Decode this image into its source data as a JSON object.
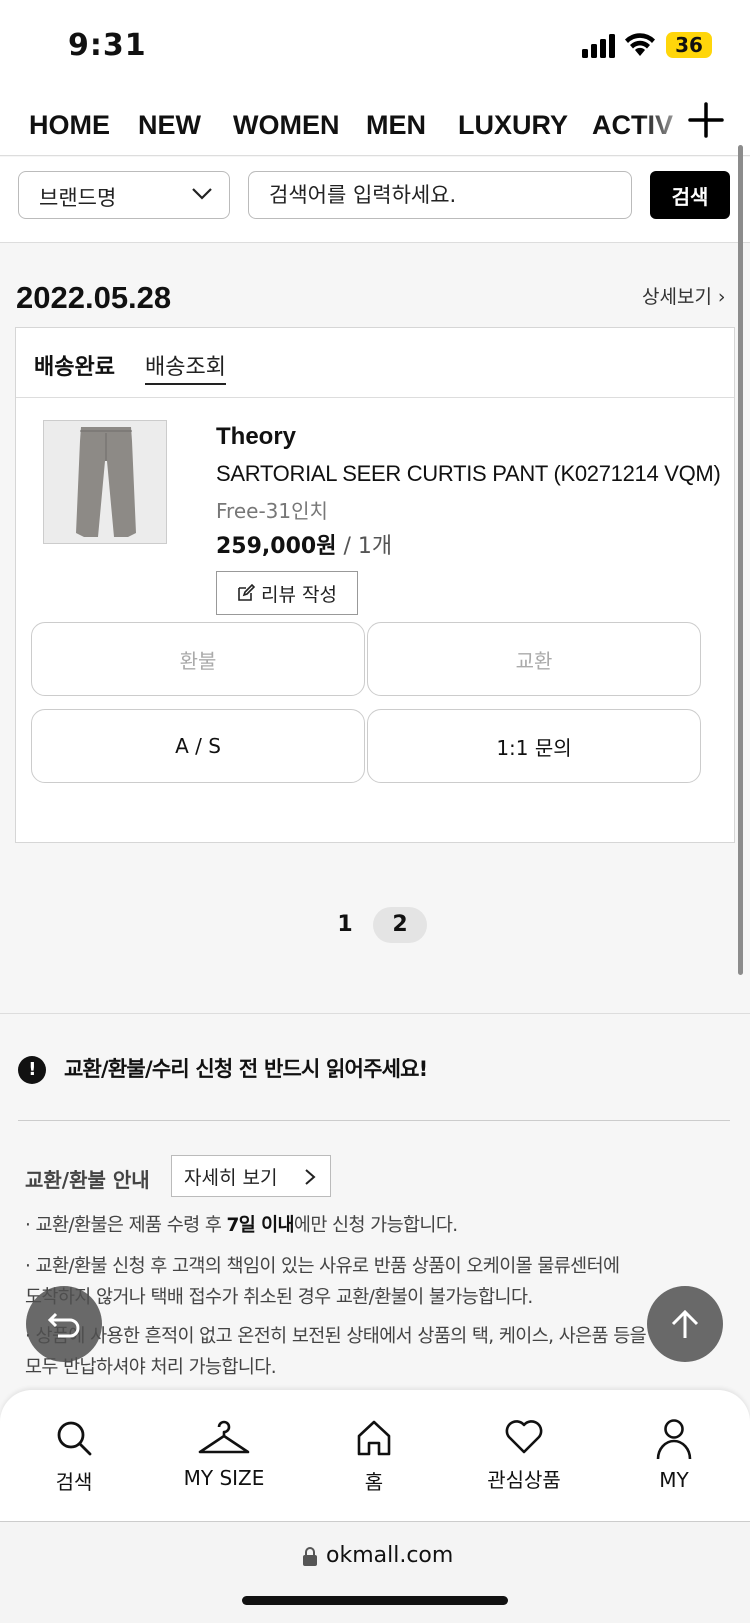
{
  "status_bar": {
    "time": "9:31",
    "battery": "36"
  },
  "nav": {
    "items": [
      "HOME",
      "NEW",
      "WOMEN",
      "MEN",
      "LUXURY",
      "ACTIV"
    ]
  },
  "search": {
    "brand_select": "브랜드명",
    "placeholder": "검색어를 입력하세요.",
    "button": "검색"
  },
  "order": {
    "date": "2022.05.28",
    "detail_link": "상세보기",
    "status": "배송완료",
    "tracking_link": "배송조회",
    "item": {
      "brand": "Theory",
      "name": "SARTORIAL SEER CURTIS PANT (K0271214 VQM)",
      "option": "Free-31인치",
      "price": "259,000원",
      "qty": " / 1개",
      "review_button": "리뷰 작성"
    },
    "actions": {
      "refund": "환불",
      "exchange": "교환",
      "as": "A / S",
      "inquiry": "1:1 문의"
    }
  },
  "pagination": {
    "pages": [
      "1",
      "2"
    ],
    "current": "2"
  },
  "notice": {
    "title": "교환/환불/수리 신청 전 반드시 읽어주세요!",
    "guide_label": "교환/환불 안내",
    "guide_button": "자세히 보기",
    "line1_pre": "· 교환/환불은 제품 수령 후 ",
    "line1_bold": "7일 이내",
    "line1_post": "에만 신청 가능합니다.",
    "line2a": "· 교환/환불 신청 후 고객의 책임이 있는 사유로 반품 상품이 오케이몰 물류센터에",
    "line2b": "도착하지 않거나 택배 접수가 취소된 경우 교환/환불이 불가능합니다.",
    "line3a": "· 상품에 사용한 흔적이 없고 온전히 보전된 상태에서 상품의 택, 케이스, 사은품 등을",
    "line3b": "모두 반납하셔야 처리 가능합니다."
  },
  "bottom_nav": {
    "search": "검색",
    "my_size": "MY SIZE",
    "home": "홈",
    "wishlist": "관심상품",
    "my": "MY"
  },
  "browser": {
    "url": "okmall.com"
  }
}
